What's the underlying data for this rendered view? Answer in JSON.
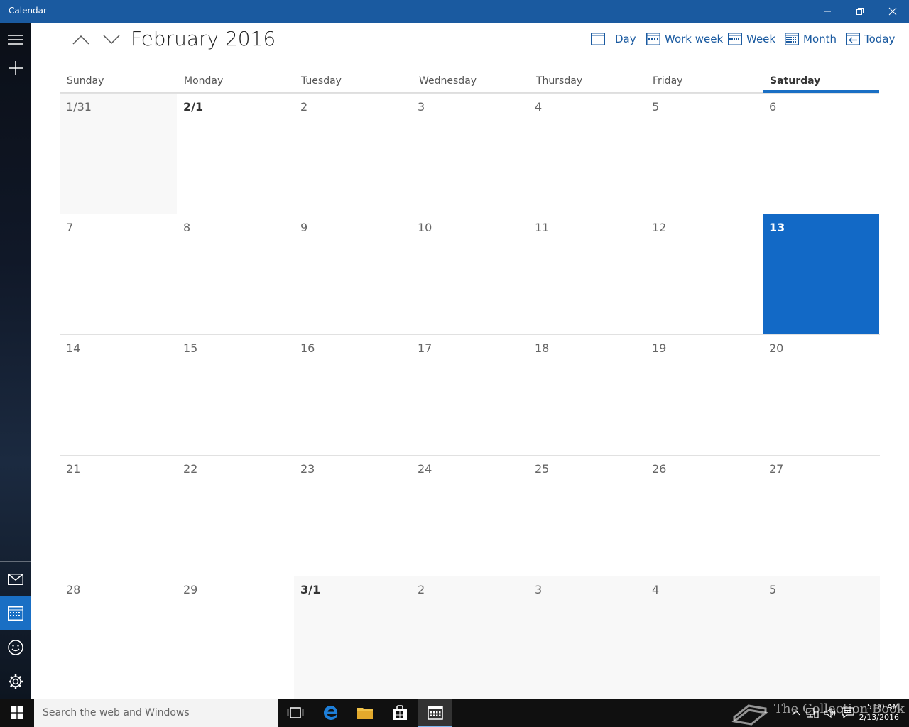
{
  "app": {
    "title": "Calendar"
  },
  "header": {
    "month_label": "February 2016",
    "views": [
      {
        "label": "Day"
      },
      {
        "label": "Work week"
      },
      {
        "label": "Week"
      },
      {
        "label": "Month"
      },
      {
        "label": "Today"
      }
    ]
  },
  "weekdays": [
    "Sunday",
    "Monday",
    "Tuesday",
    "Wednesday",
    "Thursday",
    "Friday",
    "Saturday"
  ],
  "weeks": [
    [
      "1/31",
      "2/1",
      "2",
      "3",
      "4",
      "5",
      "6"
    ],
    [
      "7",
      "8",
      "9",
      "10",
      "11",
      "12",
      "13"
    ],
    [
      "14",
      "15",
      "16",
      "17",
      "18",
      "19",
      "20"
    ],
    [
      "21",
      "22",
      "23",
      "24",
      "25",
      "26",
      "27"
    ],
    [
      "28",
      "29",
      "3/1",
      "2",
      "3",
      "4",
      "5"
    ]
  ],
  "today": "13",
  "taskbar": {
    "search_placeholder": "Search the web and Windows",
    "time": "5:50 AM",
    "date": "2/13/2016",
    "watermark": "The Collection Book"
  },
  "colors": {
    "accent": "#1269c6",
    "titlebar": "#1a5aa0"
  }
}
